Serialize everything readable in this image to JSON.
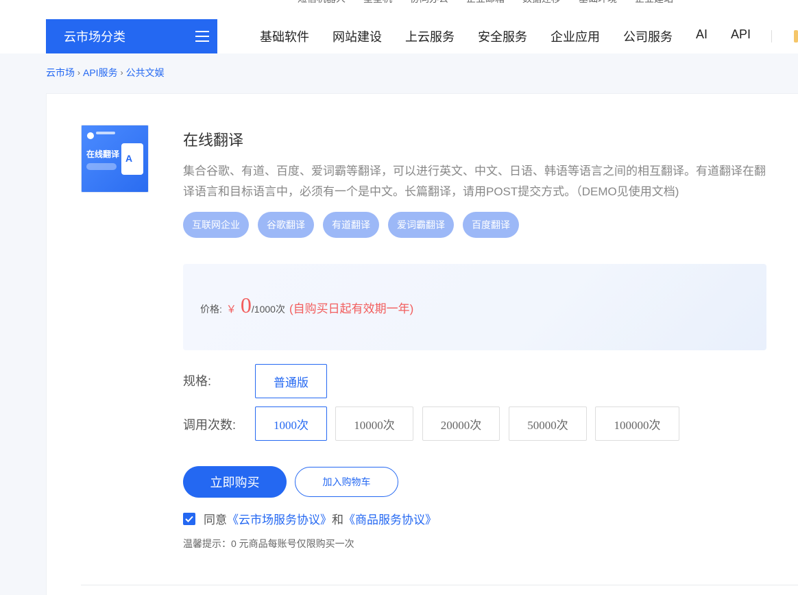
{
  "top_links": [
    "短信机器人",
    "星星机",
    "协同办公",
    "企业邮箱",
    "数据迁移",
    "基础环境",
    "企业建站"
  ],
  "category_button": {
    "label": "云市场分类",
    "icon": "menu-icon"
  },
  "nav": [
    "基础软件",
    "网站建设",
    "上云服务",
    "安全服务",
    "企业应用",
    "公司服务",
    "AI",
    "API"
  ],
  "breadcrumb": [
    "云市场",
    "API服务",
    "公共文娱"
  ],
  "product": {
    "thumbnail": {
      "title": "在线翻译"
    },
    "title": "在线翻译",
    "description": "集合谷歌、有道、百度、爱词霸等翻译，可以进行英文、中文、日语、韩语等语言之间的相互翻译。有道翻译在翻译语言和目标语言中，必须有一个是中文。长篇翻译，请用POST提交方式。（DEMO见使用文档)",
    "tags": [
      "互联网企业",
      "谷歌翻译",
      "有道翻译",
      "爱词霸翻译",
      "百度翻译"
    ]
  },
  "price": {
    "label": "价格:",
    "currency": "￥",
    "value": "0",
    "unit": "/1000次",
    "note": "(自购买日起有效期一年)"
  },
  "spec": {
    "label": "规格:",
    "options": [
      "普通版"
    ],
    "selected": "普通版"
  },
  "calls": {
    "label": "调用次数:",
    "options": [
      "1000次",
      "10000次",
      "20000次",
      "50000次",
      "100000次"
    ],
    "selected": "1000次"
  },
  "actions": {
    "buy": "立即购买",
    "cart": "加入购物车"
  },
  "agreement": {
    "prefix": "同意",
    "link1": "《云市场服务协议》",
    "middle": "和",
    "link2": "《商品服务协议》",
    "checked": true
  },
  "hint": "温馨提示：0 元商品每账号仅限购买一次",
  "colors": {
    "primary": "#2468f2",
    "price": "#f25d5d",
    "tag_bg": "#9cb8f7"
  }
}
